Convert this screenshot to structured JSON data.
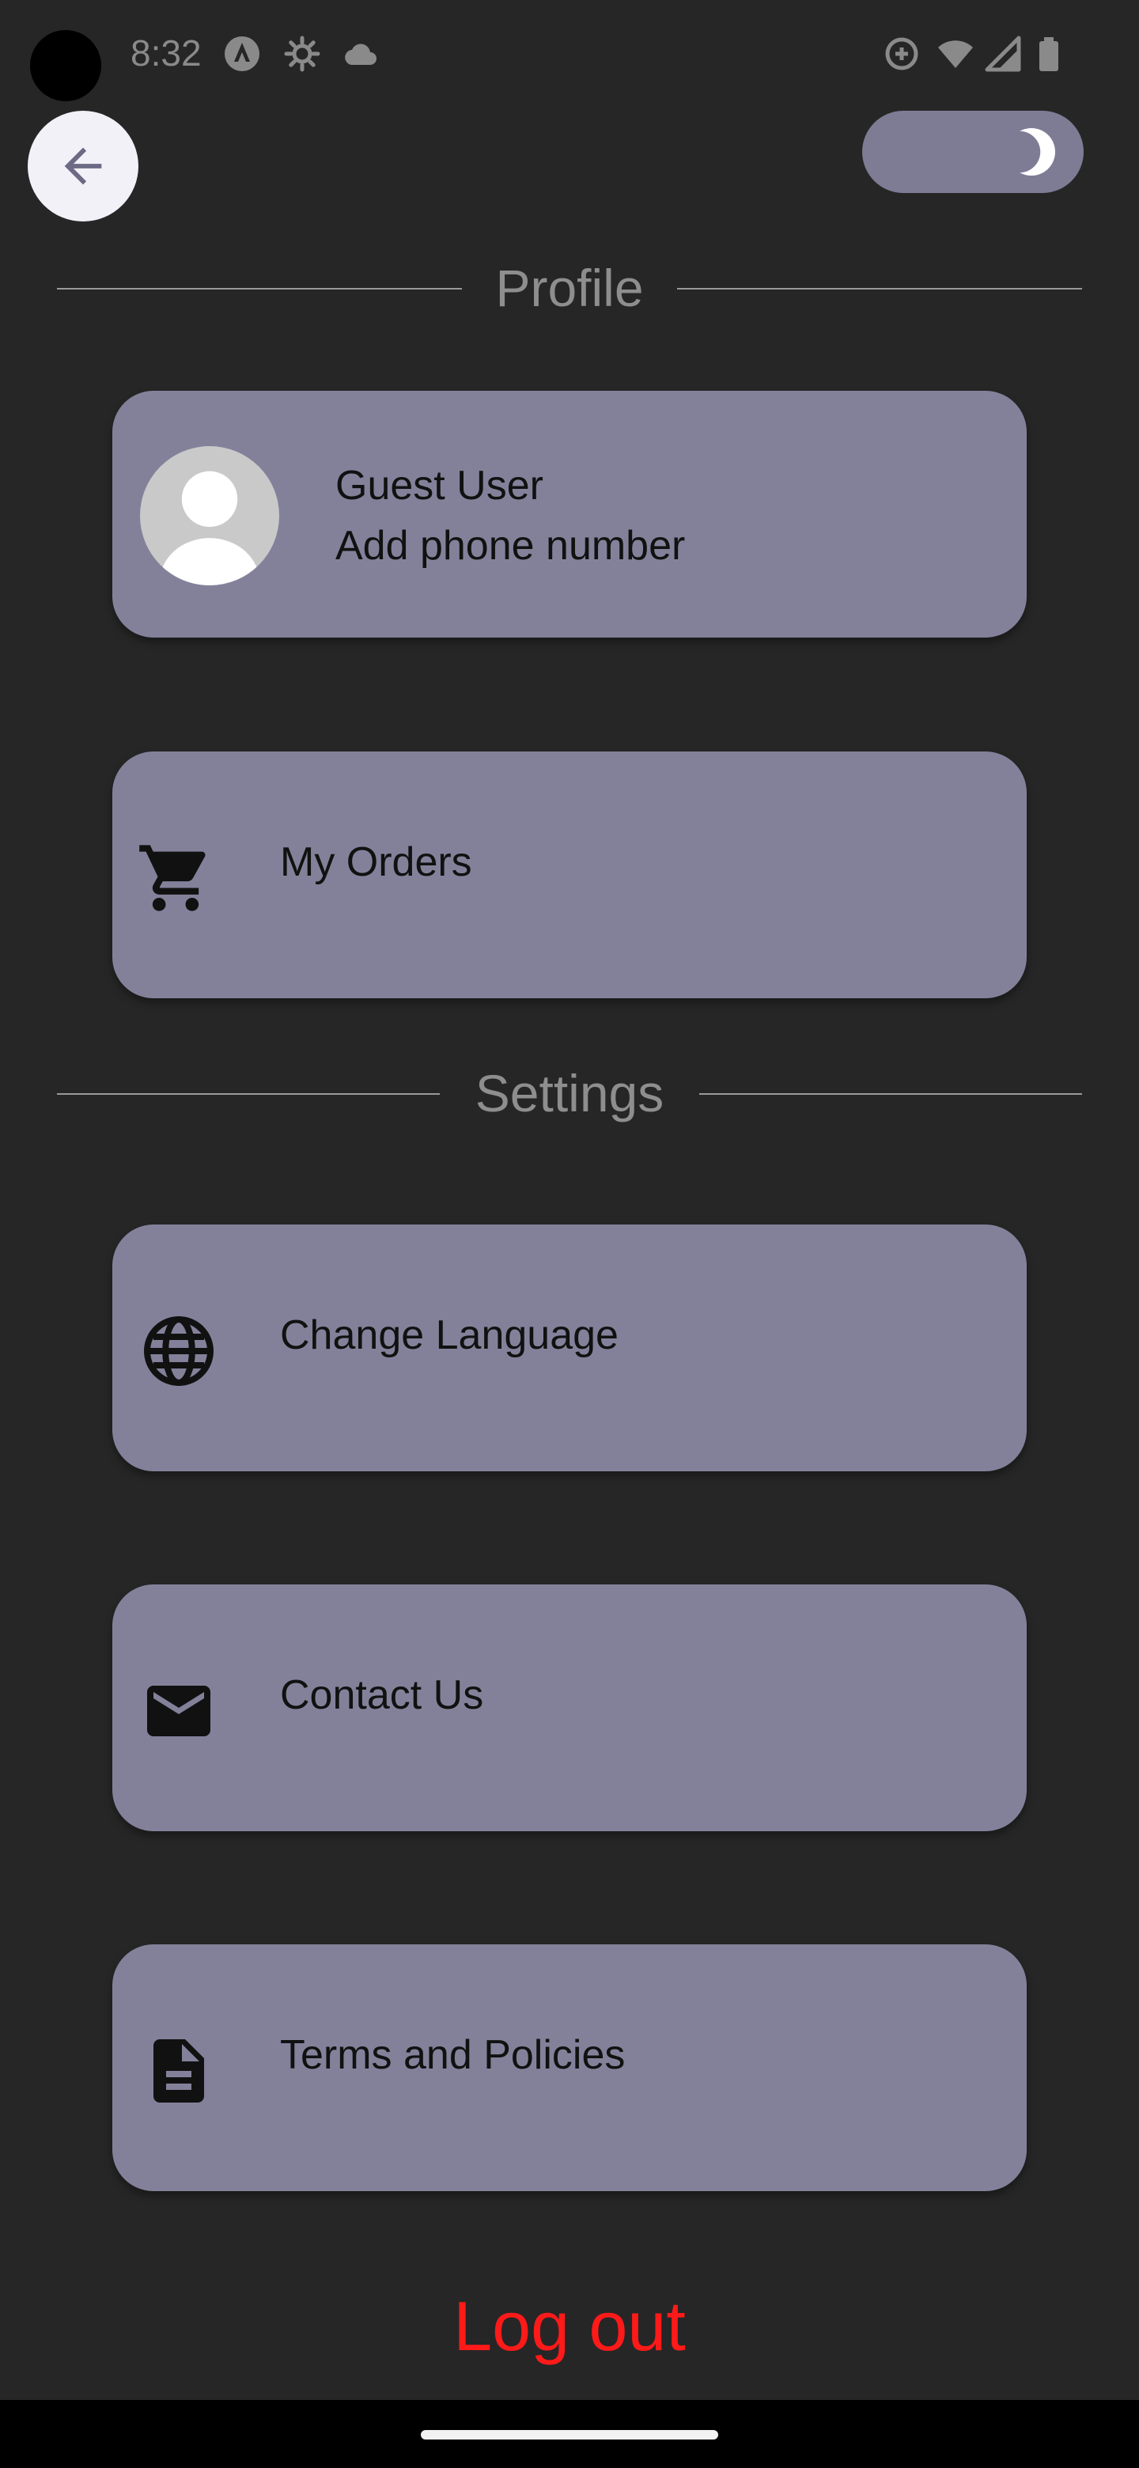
{
  "status_bar": {
    "time": "8:32",
    "left_icons": [
      "app-notification-icon",
      "settings-notification-icon",
      "cloud-icon"
    ],
    "right_icons": [
      "data-saver-icon",
      "wifi-icon",
      "signal-icon",
      "battery-icon"
    ]
  },
  "header": {
    "back_icon": "arrow-back-icon",
    "theme_toggle_icon": "moon-icon",
    "theme_toggle_on": true
  },
  "sections": {
    "profile_title": "Profile",
    "settings_title": "Settings"
  },
  "profile": {
    "name": "Guest User",
    "phone_prompt": "Add phone number",
    "avatar_icon": "person-avatar-icon"
  },
  "menu": {
    "orders": {
      "label": "My Orders",
      "icon": "shopping-cart-icon"
    },
    "language": {
      "label": "Change Language",
      "icon": "globe-icon"
    },
    "contact": {
      "label": "Contact Us",
      "icon": "mail-icon"
    },
    "terms": {
      "label": "Terms and Policies",
      "icon": "document-icon"
    }
  },
  "logout": {
    "label": "Log out"
  },
  "colors": {
    "background": "#262626",
    "card": "#83819a",
    "toggle": "#7e7c95",
    "logout": "#ff1a1a",
    "accent": "#8a87a4"
  }
}
